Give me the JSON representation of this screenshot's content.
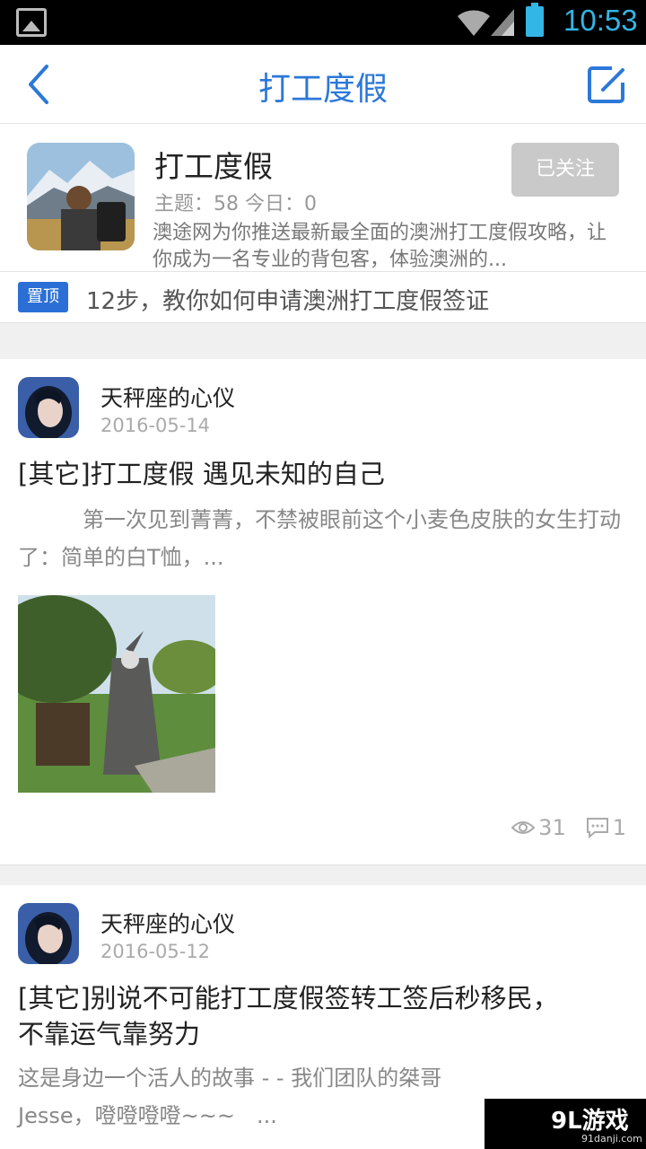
{
  "status_bar": {
    "time": "10:53"
  },
  "header": {
    "title": "打工度假"
  },
  "forum": {
    "name": "打工度假",
    "stats": "主题：58  今日：0",
    "description": "澳途网为你推送最新最全面的澳洲打工度假攻略，让你成为一名专业的背包客，体验澳洲的...",
    "follow_label": "已关注"
  },
  "pinned": {
    "badge": "置顶",
    "title": "12步，教你如何申请澳洲打工度假签证"
  },
  "posts": [
    {
      "author": "天秤座的心仪",
      "date": "2016-05-14",
      "title": "[其它]打工度假 遇见未知的自己",
      "excerpt": "　　　第一次见到菁菁，不禁被眼前这个小麦色皮肤的女生打动了：简单的白T恤，...",
      "views": "31",
      "comments": "1"
    },
    {
      "author": "天秤座的心仪",
      "date": "2016-05-12",
      "title": "[其它]别说不可能打工度假签转工签后秒移民，不靠运气靠努力",
      "excerpt": "这是身边一个活人的故事 - - 我们团队的桀哥Jesse，噔噔噔噔~~~　..."
    }
  ],
  "watermark": {
    "logo": "9L游戏",
    "url": "91danji.com"
  },
  "colors": {
    "accent": "#2b78d8",
    "pin_badge": "#2b6fd6",
    "follow_bg": "#c9c9c9",
    "status_time": "#33b5e5"
  }
}
